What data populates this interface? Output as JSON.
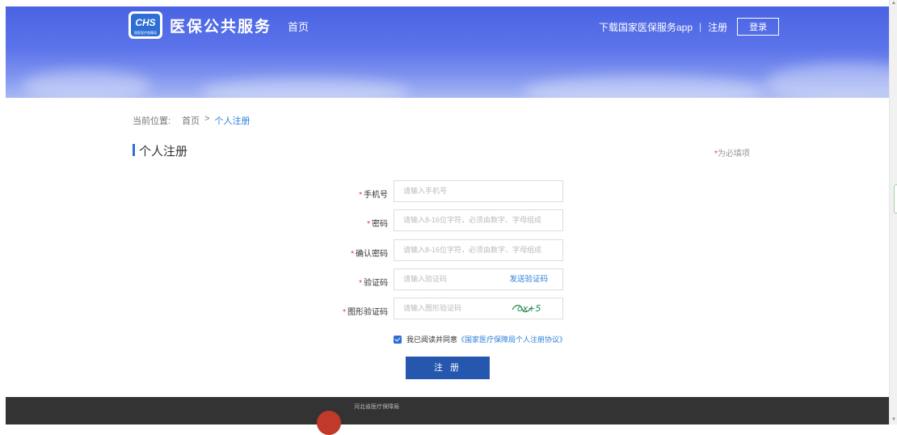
{
  "header": {
    "site_title": "医保公共服务",
    "logo_text": "CHS",
    "logo_subtext": "国家医疗保障局",
    "nav_home": "首页",
    "download_app": "下载国家医保服务app",
    "separator": "|",
    "register": "注册",
    "login": "登录"
  },
  "breadcrumb": {
    "label": "当前位置:",
    "home": "首页",
    "arrow": ">",
    "current": "个人注册"
  },
  "page": {
    "title": "个人注册",
    "required_note_mark": "*",
    "required_note": "为必填项"
  },
  "form": {
    "required_mark": "*",
    "phone": {
      "label": "手机号",
      "placeholder": "请输入手机号"
    },
    "password": {
      "label": "密码",
      "placeholder": "请输入8-16位字符，必须由数字、字母组成"
    },
    "confirm_password": {
      "label": "确认密码",
      "placeholder": "请输入8-16位字符，必须由数字、字母组成"
    },
    "sms_code": {
      "label": "验证码",
      "placeholder": "请输入验证码",
      "send_label": "发送验证码"
    },
    "captcha": {
      "label": "图形验证码",
      "placeholder": "请输入图形验证码",
      "captcha_text": "ox+5"
    },
    "agreement": {
      "checked": true,
      "text": "我已阅读并同意",
      "link": "《国家医疗保障局个人注册协议》"
    },
    "submit_label": "注 册"
  },
  "footer": {
    "org_name": "河北省医疗保障局"
  },
  "colors": {
    "accent": "#2e6fd6",
    "button": "#2557ae",
    "required": "#e33333",
    "footer_bg": "#333333"
  }
}
